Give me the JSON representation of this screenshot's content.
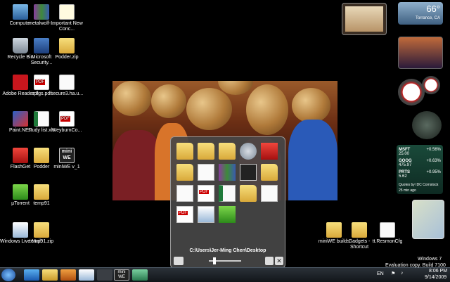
{
  "desktop": {
    "icons_left": [
      {
        "label": "Computer",
        "icon": "computer-icon"
      },
      {
        "label": "metalwolf-...",
        "icon": "archive-icon"
      },
      {
        "label": "Important New Conc...",
        "icon": "document-icon"
      },
      {
        "label": "Recycle Bin",
        "icon": "recycle-bin-icon"
      },
      {
        "label": "Microsoft Security...",
        "icon": "security-icon"
      },
      {
        "label": "Podder.zip",
        "icon": "zip-folder-icon"
      },
      {
        "label": "Adobe Reader 8",
        "icon": "adobe-reader-icon"
      },
      {
        "label": "spfgs.pdf",
        "icon": "pdf-icon"
      },
      {
        "label": "secure3.ha.u...",
        "icon": "document-icon"
      },
      {
        "label": "Paint.NET",
        "icon": "paint-net-icon"
      },
      {
        "label": "study list.xls",
        "icon": "excel-icon"
      },
      {
        "label": "WeyburnCo...",
        "icon": "pdf-icon"
      },
      {
        "label": "FlashGet",
        "icon": "flashget-icon"
      },
      {
        "label": "Podder",
        "icon": "folder-icon"
      },
      {
        "label": "miniWE v_1",
        "icon": "miniwe-icon"
      },
      {
        "label": "µTorrent",
        "icon": "utorrent-icon"
      },
      {
        "label": "temp91",
        "icon": "zip-folder-icon"
      },
      {
        "label": "Windows Live Mail",
        "icon": "mail-icon"
      },
      {
        "label": "temp91.zip",
        "icon": "zip-folder-icon"
      }
    ],
    "icons_right": [
      {
        "label": "miniWE builds",
        "icon": "folder-icon"
      },
      {
        "label": "Gadgets - Shortcut",
        "icon": "folder-shortcut-icon"
      },
      {
        "label": "tt.ResmonCfg",
        "icon": "config-icon"
      }
    ]
  },
  "weather": {
    "temperature": "66°",
    "location": "Torrance, CA"
  },
  "stocks": [
    {
      "symbol": "MSFT",
      "price": "25.00",
      "change": "+0.56%"
    },
    {
      "symbol": "GOOG",
      "price": "475.97",
      "change": "+0.63%"
    },
    {
      "symbol": "PRTS",
      "price": "5.62",
      "change": "+0.95%"
    }
  ],
  "stocks_footer": "Quotes by IDC Comstock",
  "stocks_time": "25 min ago",
  "launcher": {
    "path": "C:\\Users\\Jer-Ming Chen\\Desktop"
  },
  "taskbar": {
    "language": "EN",
    "time": "8:06 PM",
    "date": "9/14/2009",
    "watermark_line1": "Windows 7",
    "watermark_line2": "Evaluation copy. Build 7100",
    "miniwe_label": "mini WE"
  },
  "colors": {
    "accent": "#3a7bd5",
    "launcher_bg": "#464646",
    "taskbar": "#1a1f24"
  }
}
